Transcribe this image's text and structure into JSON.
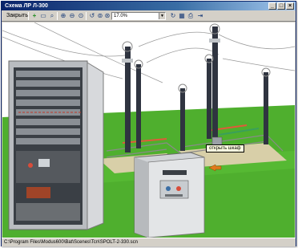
{
  "window": {
    "title": "Схема ЛР Л-300"
  },
  "toolbar": {
    "close_label": "Закрыть",
    "zoom_value": "17.0%",
    "tools": [
      {
        "name": "add-icon",
        "glyph": "+"
      },
      {
        "name": "page-icon",
        "glyph": "▭"
      },
      {
        "name": "find-icon",
        "glyph": "⌕"
      },
      {
        "name": "zoom-in-icon",
        "glyph": "⊕"
      },
      {
        "name": "zoom-out-icon",
        "glyph": "⊖"
      },
      {
        "name": "zoom-area-icon",
        "glyph": "⊙"
      },
      {
        "name": "rotate-left-icon",
        "glyph": "↺"
      },
      {
        "name": "zoom-fit-icon",
        "glyph": "⊚"
      },
      {
        "name": "zoom-reset-icon",
        "glyph": "⊛"
      },
      {
        "name": "rotate-right-icon",
        "glyph": "↻"
      },
      {
        "name": "tiles-icon",
        "glyph": "▦"
      },
      {
        "name": "print-icon",
        "glyph": "⎙"
      },
      {
        "name": "exit-icon",
        "glyph": "⇥"
      }
    ]
  },
  "scene": {
    "tooltip": "открыть шкаф"
  },
  "status": {
    "path": "C:\\Program Files\\Modus600\\Bat\\Scenes\\Tcn\\SPOLT-2-330.scn"
  },
  "colors": {
    "sky": "#ffffff",
    "ground": "#4faf2e",
    "insulator": "#2f3440",
    "cabinet": "#d9d9d9",
    "accent": "#e07a1a"
  }
}
